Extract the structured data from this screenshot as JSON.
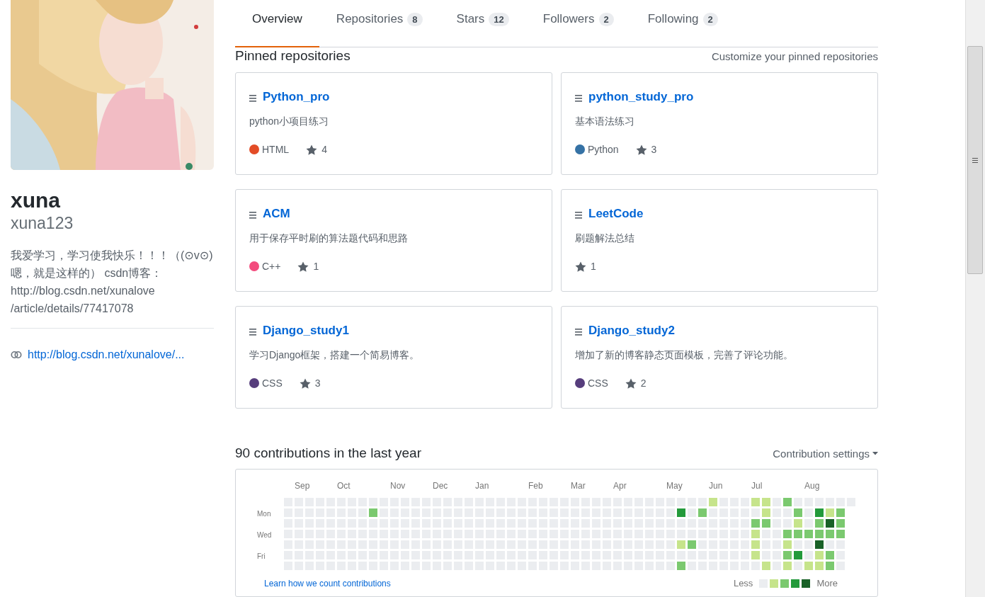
{
  "profile": {
    "full_name": "xuna",
    "username": "xuna123",
    "bio": "我爱学习，学习使我快乐！！！（(⊙v⊙)嗯，就是这样的） csdn博客：http://blog.csdn.net/xunalove /article/details/77417078",
    "link": "http://blog.csdn.net/xunalove/..."
  },
  "tabs": [
    {
      "label": "Overview",
      "selected": true
    },
    {
      "label": "Repositories",
      "count": "8",
      "selected": false
    },
    {
      "label": "Stars",
      "count": "12",
      "selected": false
    },
    {
      "label": "Followers",
      "count": "2",
      "selected": false
    },
    {
      "label": "Following",
      "count": "2",
      "selected": false
    }
  ],
  "pinned": {
    "title": "Pinned repositories",
    "customize": "Customize your pinned repositories",
    "repos": [
      {
        "name": "Python_pro",
        "description": "python小项目练习",
        "language": "HTML",
        "color": "#e34c26",
        "stars": "4"
      },
      {
        "name": "python_study_pro",
        "description": "基本语法练习",
        "language": "Python",
        "color": "#3572a5",
        "stars": "3"
      },
      {
        "name": "ACM",
        "description": "用于保存平时刷的算法题代码和思路",
        "language": "C++",
        "color": "#f34b7d",
        "stars": "1"
      },
      {
        "name": "LeetCode",
        "description": "刷题解法总结",
        "stars": "1"
      },
      {
        "name": "Django_study1",
        "description": "学习Django框架，搭建一个简易博客。",
        "language": "CSS",
        "color": "#563d7c",
        "stars": "3"
      },
      {
        "name": "Django_study2",
        "description": "增加了新的博客静态页面模板，完善了评论功能。",
        "language": "CSS",
        "color": "#563d7c",
        "stars": "2"
      }
    ]
  },
  "contributions": {
    "title": "90 contributions in the last year",
    "settings": "Contribution settings",
    "day_labels": [
      "Mon",
      "Wed",
      "Fri"
    ],
    "weeks": [
      {
        "days": [
          {
            "color": "#ebedf0"
          },
          {
            "color": "#ebedf0"
          },
          {
            "color": "#ebedf0"
          },
          {
            "color": "#ebedf0"
          },
          {
            "color": "#ebedf0"
          },
          {
            "color": "#ebedf0"
          },
          {
            "color": "#ebedf0"
          }
        ]
      },
      {
        "month": "Sep",
        "days": [
          {
            "color": "#ebedf0"
          },
          {
            "color": "#ebedf0"
          },
          {
            "color": "#ebedf0"
          },
          {
            "color": "#ebedf0"
          },
          {
            "color": "#ebedf0"
          },
          {
            "color": "#ebedf0"
          },
          {
            "color": "#ebedf0"
          }
        ]
      },
      {
        "days": [
          {
            "color": "#ebedf0"
          },
          {
            "color": "#ebedf0"
          },
          {
            "color": "#ebedf0"
          },
          {
            "color": "#ebedf0"
          },
          {
            "color": "#ebedf0"
          },
          {
            "color": "#ebedf0"
          },
          {
            "color": "#ebedf0"
          }
        ]
      },
      {
        "days": [
          {
            "color": "#ebedf0"
          },
          {
            "color": "#ebedf0"
          },
          {
            "color": "#ebedf0"
          },
          {
            "color": "#ebedf0"
          },
          {
            "color": "#ebedf0"
          },
          {
            "color": "#ebedf0"
          },
          {
            "color": "#ebedf0"
          }
        ]
      },
      {
        "days": [
          {
            "color": "#ebedf0"
          },
          {
            "color": "#ebedf0"
          },
          {
            "color": "#ebedf0"
          },
          {
            "color": "#ebedf0"
          },
          {
            "color": "#ebedf0"
          },
          {
            "color": "#ebedf0"
          },
          {
            "color": "#ebedf0"
          }
        ]
      },
      {
        "month": "Oct",
        "days": [
          {
            "color": "#ebedf0"
          },
          {
            "color": "#ebedf0"
          },
          {
            "color": "#ebedf0"
          },
          {
            "color": "#ebedf0"
          },
          {
            "color": "#ebedf0"
          },
          {
            "color": "#ebedf0"
          },
          {
            "color": "#ebedf0"
          }
        ]
      },
      {
        "days": [
          {
            "color": "#ebedf0"
          },
          {
            "color": "#ebedf0"
          },
          {
            "color": "#ebedf0"
          },
          {
            "color": "#ebedf0"
          },
          {
            "color": "#ebedf0"
          },
          {
            "color": "#ebedf0"
          },
          {
            "color": "#ebedf0"
          }
        ]
      },
      {
        "days": [
          {
            "color": "#ebedf0"
          },
          {
            "color": "#ebedf0"
          },
          {
            "color": "#ebedf0"
          },
          {
            "color": "#ebedf0"
          },
          {
            "color": "#ebedf0"
          },
          {
            "color": "#ebedf0"
          },
          {
            "color": "#ebedf0"
          }
        ]
      },
      {
        "days": [
          {
            "color": "#ebedf0"
          },
          {
            "color": "#7bc96f"
          },
          {
            "color": "#ebedf0"
          },
          {
            "color": "#ebedf0"
          },
          {
            "color": "#ebedf0"
          },
          {
            "color": "#ebedf0"
          },
          {
            "color": "#ebedf0"
          }
        ]
      },
      {
        "days": [
          {
            "color": "#ebedf0"
          },
          {
            "color": "#ebedf0"
          },
          {
            "color": "#ebedf0"
          },
          {
            "color": "#ebedf0"
          },
          {
            "color": "#ebedf0"
          },
          {
            "color": "#ebedf0"
          },
          {
            "color": "#ebedf0"
          }
        ]
      },
      {
        "month": "Nov",
        "days": [
          {
            "color": "#ebedf0"
          },
          {
            "color": "#ebedf0"
          },
          {
            "color": "#ebedf0"
          },
          {
            "color": "#ebedf0"
          },
          {
            "color": "#ebedf0"
          },
          {
            "color": "#ebedf0"
          },
          {
            "color": "#ebedf0"
          }
        ]
      },
      {
        "days": [
          {
            "color": "#ebedf0"
          },
          {
            "color": "#ebedf0"
          },
          {
            "color": "#ebedf0"
          },
          {
            "color": "#ebedf0"
          },
          {
            "color": "#ebedf0"
          },
          {
            "color": "#ebedf0"
          },
          {
            "color": "#ebedf0"
          }
        ]
      },
      {
        "days": [
          {
            "color": "#ebedf0"
          },
          {
            "color": "#ebedf0"
          },
          {
            "color": "#ebedf0"
          },
          {
            "color": "#ebedf0"
          },
          {
            "color": "#ebedf0"
          },
          {
            "color": "#ebedf0"
          },
          {
            "color": "#ebedf0"
          }
        ]
      },
      {
        "days": [
          {
            "color": "#ebedf0"
          },
          {
            "color": "#ebedf0"
          },
          {
            "color": "#ebedf0"
          },
          {
            "color": "#ebedf0"
          },
          {
            "color": "#ebedf0"
          },
          {
            "color": "#ebedf0"
          },
          {
            "color": "#ebedf0"
          }
        ]
      },
      {
        "month": "Dec",
        "days": [
          {
            "color": "#ebedf0"
          },
          {
            "color": "#ebedf0"
          },
          {
            "color": "#ebedf0"
          },
          {
            "color": "#ebedf0"
          },
          {
            "color": "#ebedf0"
          },
          {
            "color": "#ebedf0"
          },
          {
            "color": "#ebedf0"
          }
        ]
      },
      {
        "days": [
          {
            "color": "#ebedf0"
          },
          {
            "color": "#ebedf0"
          },
          {
            "color": "#ebedf0"
          },
          {
            "color": "#ebedf0"
          },
          {
            "color": "#ebedf0"
          },
          {
            "color": "#ebedf0"
          },
          {
            "color": "#ebedf0"
          }
        ]
      },
      {
        "days": [
          {
            "color": "#ebedf0"
          },
          {
            "color": "#ebedf0"
          },
          {
            "color": "#ebedf0"
          },
          {
            "color": "#ebedf0"
          },
          {
            "color": "#ebedf0"
          },
          {
            "color": "#ebedf0"
          },
          {
            "color": "#ebedf0"
          }
        ]
      },
      {
        "days": [
          {
            "color": "#ebedf0"
          },
          {
            "color": "#ebedf0"
          },
          {
            "color": "#ebedf0"
          },
          {
            "color": "#ebedf0"
          },
          {
            "color": "#ebedf0"
          },
          {
            "color": "#ebedf0"
          },
          {
            "color": "#ebedf0"
          }
        ]
      },
      {
        "month": "Jan",
        "days": [
          {
            "color": "#ebedf0"
          },
          {
            "color": "#ebedf0"
          },
          {
            "color": "#ebedf0"
          },
          {
            "color": "#ebedf0"
          },
          {
            "color": "#ebedf0"
          },
          {
            "color": "#ebedf0"
          },
          {
            "color": "#ebedf0"
          }
        ]
      },
      {
        "days": [
          {
            "color": "#ebedf0"
          },
          {
            "color": "#ebedf0"
          },
          {
            "color": "#ebedf0"
          },
          {
            "color": "#ebedf0"
          },
          {
            "color": "#ebedf0"
          },
          {
            "color": "#ebedf0"
          },
          {
            "color": "#ebedf0"
          }
        ]
      },
      {
        "days": [
          {
            "color": "#ebedf0"
          },
          {
            "color": "#ebedf0"
          },
          {
            "color": "#ebedf0"
          },
          {
            "color": "#ebedf0"
          },
          {
            "color": "#ebedf0"
          },
          {
            "color": "#ebedf0"
          },
          {
            "color": "#ebedf0"
          }
        ]
      },
      {
        "days": [
          {
            "color": "#ebedf0"
          },
          {
            "color": "#ebedf0"
          },
          {
            "color": "#ebedf0"
          },
          {
            "color": "#ebedf0"
          },
          {
            "color": "#ebedf0"
          },
          {
            "color": "#ebedf0"
          },
          {
            "color": "#ebedf0"
          }
        ]
      },
      {
        "days": [
          {
            "color": "#ebedf0"
          },
          {
            "color": "#ebedf0"
          },
          {
            "color": "#ebedf0"
          },
          {
            "color": "#ebedf0"
          },
          {
            "color": "#ebedf0"
          },
          {
            "color": "#ebedf0"
          },
          {
            "color": "#ebedf0"
          }
        ]
      },
      {
        "month": "Feb",
        "days": [
          {
            "color": "#ebedf0"
          },
          {
            "color": "#ebedf0"
          },
          {
            "color": "#ebedf0"
          },
          {
            "color": "#ebedf0"
          },
          {
            "color": "#ebedf0"
          },
          {
            "color": "#ebedf0"
          },
          {
            "color": "#ebedf0"
          }
        ]
      },
      {
        "days": [
          {
            "color": "#ebedf0"
          },
          {
            "color": "#ebedf0"
          },
          {
            "color": "#ebedf0"
          },
          {
            "color": "#ebedf0"
          },
          {
            "color": "#ebedf0"
          },
          {
            "color": "#ebedf0"
          },
          {
            "color": "#ebedf0"
          }
        ]
      },
      {
        "days": [
          {
            "color": "#ebedf0"
          },
          {
            "color": "#ebedf0"
          },
          {
            "color": "#ebedf0"
          },
          {
            "color": "#ebedf0"
          },
          {
            "color": "#ebedf0"
          },
          {
            "color": "#ebedf0"
          },
          {
            "color": "#ebedf0"
          }
        ]
      },
      {
        "days": [
          {
            "color": "#ebedf0"
          },
          {
            "color": "#ebedf0"
          },
          {
            "color": "#ebedf0"
          },
          {
            "color": "#ebedf0"
          },
          {
            "color": "#ebedf0"
          },
          {
            "color": "#ebedf0"
          },
          {
            "color": "#ebedf0"
          }
        ]
      },
      {
        "month": "Mar",
        "days": [
          {
            "color": "#ebedf0"
          },
          {
            "color": "#ebedf0"
          },
          {
            "color": "#ebedf0"
          },
          {
            "color": "#ebedf0"
          },
          {
            "color": "#ebedf0"
          },
          {
            "color": "#ebedf0"
          },
          {
            "color": "#ebedf0"
          }
        ]
      },
      {
        "days": [
          {
            "color": "#ebedf0"
          },
          {
            "color": "#ebedf0"
          },
          {
            "color": "#ebedf0"
          },
          {
            "color": "#ebedf0"
          },
          {
            "color": "#ebedf0"
          },
          {
            "color": "#ebedf0"
          },
          {
            "color": "#ebedf0"
          }
        ]
      },
      {
        "days": [
          {
            "color": "#ebedf0"
          },
          {
            "color": "#ebedf0"
          },
          {
            "color": "#ebedf0"
          },
          {
            "color": "#ebedf0"
          },
          {
            "color": "#ebedf0"
          },
          {
            "color": "#ebedf0"
          },
          {
            "color": "#ebedf0"
          }
        ]
      },
      {
        "days": [
          {
            "color": "#ebedf0"
          },
          {
            "color": "#ebedf0"
          },
          {
            "color": "#ebedf0"
          },
          {
            "color": "#ebedf0"
          },
          {
            "color": "#ebedf0"
          },
          {
            "color": "#ebedf0"
          },
          {
            "color": "#ebedf0"
          }
        ]
      },
      {
        "month": "Apr",
        "days": [
          {
            "color": "#ebedf0"
          },
          {
            "color": "#ebedf0"
          },
          {
            "color": "#ebedf0"
          },
          {
            "color": "#ebedf0"
          },
          {
            "color": "#ebedf0"
          },
          {
            "color": "#ebedf0"
          },
          {
            "color": "#ebedf0"
          }
        ]
      },
      {
        "days": [
          {
            "color": "#ebedf0"
          },
          {
            "color": "#ebedf0"
          },
          {
            "color": "#ebedf0"
          },
          {
            "color": "#ebedf0"
          },
          {
            "color": "#ebedf0"
          },
          {
            "color": "#ebedf0"
          },
          {
            "color": "#ebedf0"
          }
        ]
      },
      {
        "days": [
          {
            "color": "#ebedf0"
          },
          {
            "color": "#ebedf0"
          },
          {
            "color": "#ebedf0"
          },
          {
            "color": "#ebedf0"
          },
          {
            "color": "#ebedf0"
          },
          {
            "color": "#ebedf0"
          },
          {
            "color": "#ebedf0"
          }
        ]
      },
      {
        "days": [
          {
            "color": "#ebedf0"
          },
          {
            "color": "#ebedf0"
          },
          {
            "color": "#ebedf0"
          },
          {
            "color": "#ebedf0"
          },
          {
            "color": "#ebedf0"
          },
          {
            "color": "#ebedf0"
          },
          {
            "color": "#ebedf0"
          }
        ]
      },
      {
        "days": [
          {
            "color": "#ebedf0"
          },
          {
            "color": "#ebedf0"
          },
          {
            "color": "#ebedf0"
          },
          {
            "color": "#ebedf0"
          },
          {
            "color": "#ebedf0"
          },
          {
            "color": "#ebedf0"
          },
          {
            "color": "#ebedf0"
          }
        ]
      },
      {
        "month": "May",
        "days": [
          {
            "color": "#ebedf0"
          },
          {
            "color": "#ebedf0"
          },
          {
            "color": "#ebedf0"
          },
          {
            "color": "#ebedf0"
          },
          {
            "color": "#ebedf0"
          },
          {
            "color": "#ebedf0"
          },
          {
            "color": "#ebedf0"
          }
        ]
      },
      {
        "days": [
          {
            "color": "#ebedf0"
          },
          {
            "color": "#239a3b"
          },
          {
            "color": "#ebedf0"
          },
          {
            "color": "#ebedf0"
          },
          {
            "color": "#c6e48b"
          },
          {
            "color": "#ebedf0"
          },
          {
            "color": "#7bc96f"
          }
        ]
      },
      {
        "days": [
          {
            "color": "#ebedf0"
          },
          {
            "color": "#ebedf0"
          },
          {
            "color": "#ebedf0"
          },
          {
            "color": "#ebedf0"
          },
          {
            "color": "#7bc96f"
          },
          {
            "color": "#ebedf0"
          },
          {
            "color": "#ebedf0"
          }
        ]
      },
      {
        "days": [
          {
            "color": "#ebedf0"
          },
          {
            "color": "#7bc96f"
          },
          {
            "color": "#ebedf0"
          },
          {
            "color": "#ebedf0"
          },
          {
            "color": "#ebedf0"
          },
          {
            "color": "#ebedf0"
          },
          {
            "color": "#ebedf0"
          }
        ]
      },
      {
        "month": "Jun",
        "days": [
          {
            "color": "#c6e48b"
          },
          {
            "color": "#ebedf0"
          },
          {
            "color": "#ebedf0"
          },
          {
            "color": "#ebedf0"
          },
          {
            "color": "#ebedf0"
          },
          {
            "color": "#ebedf0"
          },
          {
            "color": "#ebedf0"
          }
        ]
      },
      {
        "days": [
          {
            "color": "#ebedf0"
          },
          {
            "color": "#ebedf0"
          },
          {
            "color": "#ebedf0"
          },
          {
            "color": "#ebedf0"
          },
          {
            "color": "#ebedf0"
          },
          {
            "color": "#ebedf0"
          },
          {
            "color": "#ebedf0"
          }
        ]
      },
      {
        "days": [
          {
            "color": "#ebedf0"
          },
          {
            "color": "#ebedf0"
          },
          {
            "color": "#ebedf0"
          },
          {
            "color": "#ebedf0"
          },
          {
            "color": "#ebedf0"
          },
          {
            "color": "#ebedf0"
          },
          {
            "color": "#ebedf0"
          }
        ]
      },
      {
        "days": [
          {
            "color": "#ebedf0"
          },
          {
            "color": "#ebedf0"
          },
          {
            "color": "#ebedf0"
          },
          {
            "color": "#ebedf0"
          },
          {
            "color": "#ebedf0"
          },
          {
            "color": "#ebedf0"
          },
          {
            "color": "#ebedf0"
          }
        ]
      },
      {
        "month": "Jul",
        "days": [
          {
            "color": "#c6e48b"
          },
          {
            "color": "#ebedf0"
          },
          {
            "color": "#7bc96f"
          },
          {
            "color": "#c6e48b"
          },
          {
            "color": "#c6e48b"
          },
          {
            "color": "#c6e48b"
          },
          {
            "color": "#ebedf0"
          }
        ]
      },
      {
        "days": [
          {
            "color": "#c6e48b"
          },
          {
            "color": "#c6e48b"
          },
          {
            "color": "#7bc96f"
          },
          {
            "color": "#ebedf0"
          },
          {
            "color": "#ebedf0"
          },
          {
            "color": "#ebedf0"
          },
          {
            "color": "#c6e48b"
          }
        ]
      },
      {
        "days": [
          {
            "color": "#ebedf0"
          },
          {
            "color": "#ebedf0"
          },
          {
            "color": "#ebedf0"
          },
          {
            "color": "#ebedf0"
          },
          {
            "color": "#ebedf0"
          },
          {
            "color": "#ebedf0"
          },
          {
            "color": "#ebedf0"
          }
        ]
      },
      {
        "days": [
          {
            "color": "#7bc96f"
          },
          {
            "color": "#ebedf0"
          },
          {
            "color": "#ebedf0"
          },
          {
            "color": "#7bc96f"
          },
          {
            "color": "#c6e48b"
          },
          {
            "color": "#7bc96f"
          },
          {
            "color": "#c6e48b"
          }
        ]
      },
      {
        "days": [
          {
            "color": "#ebedf0"
          },
          {
            "color": "#7bc96f"
          },
          {
            "color": "#c6e48b"
          },
          {
            "color": "#7bc96f"
          },
          {
            "color": "#ebedf0"
          },
          {
            "color": "#239a3b"
          },
          {
            "color": "#ebedf0"
          }
        ]
      },
      {
        "month": "Aug",
        "days": [
          {
            "color": "#ebedf0"
          },
          {
            "color": "#ebedf0"
          },
          {
            "color": "#ebedf0"
          },
          {
            "color": "#7bc96f"
          },
          {
            "color": "#ebedf0"
          },
          {
            "color": "#ebedf0"
          },
          {
            "color": "#c6e48b"
          }
        ]
      },
      {
        "days": [
          {
            "color": "#ebedf0"
          },
          {
            "color": "#239a3b"
          },
          {
            "color": "#7bc96f"
          },
          {
            "color": "#7bc96f"
          },
          {
            "color": "#196127"
          },
          {
            "color": "#c6e48b"
          },
          {
            "color": "#c6e48b"
          }
        ]
      },
      {
        "days": [
          {
            "color": "#ebedf0"
          },
          {
            "color": "#c6e48b"
          },
          {
            "color": "#196127"
          },
          {
            "color": "#7bc96f"
          },
          {
            "color": "#ebedf0"
          },
          {
            "color": "#7bc96f"
          },
          {
            "color": "#7bc96f"
          }
        ]
      },
      {
        "days": [
          {
            "color": "#ebedf0"
          },
          {
            "color": "#7bc96f"
          },
          {
            "color": "#7bc96f"
          },
          {
            "color": "#7bc96f"
          },
          {
            "color": "#ebedf0"
          },
          {
            "color": "#ebedf0"
          },
          {
            "color": "#ebedf0"
          }
        ]
      },
      {
        "days": [
          {
            "color": "#ebedf0"
          }
        ]
      }
    ],
    "learn_link": "Learn how we count contributions",
    "legend_less": "Less",
    "legend_more": "More",
    "legend": [
      {
        "color": "#ebedf0"
      },
      {
        "color": "#c6e48b"
      },
      {
        "color": "#7bc96f"
      },
      {
        "color": "#239a3b"
      },
      {
        "color": "#196127"
      }
    ]
  }
}
